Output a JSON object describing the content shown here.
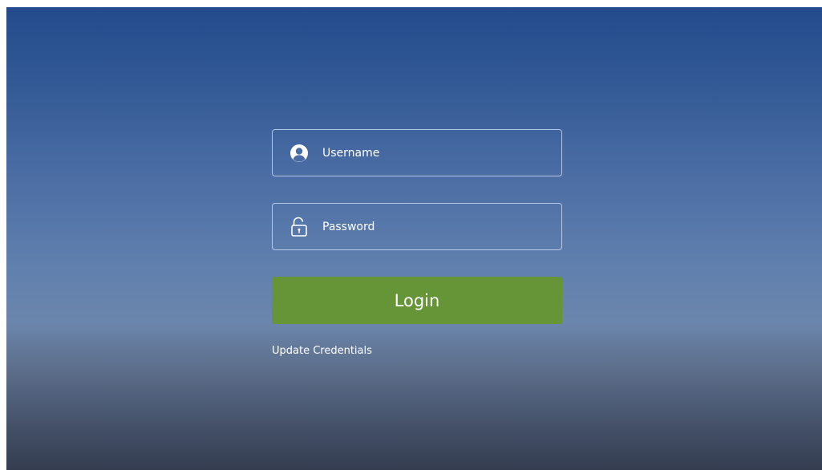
{
  "login_form": {
    "username": {
      "placeholder": "Username",
      "value": "",
      "icon": "user-icon"
    },
    "password": {
      "placeholder": "Password",
      "value": "",
      "icon": "unlocked-padlock-icon"
    },
    "login_label": "Login",
    "update_credentials_label": "Update Credentials"
  },
  "colors": {
    "background_top": "#234a8c",
    "background_bottom": "#343d50",
    "login_button": "#659536",
    "field_border": "#c8d7f0",
    "text": "#ffffff"
  }
}
